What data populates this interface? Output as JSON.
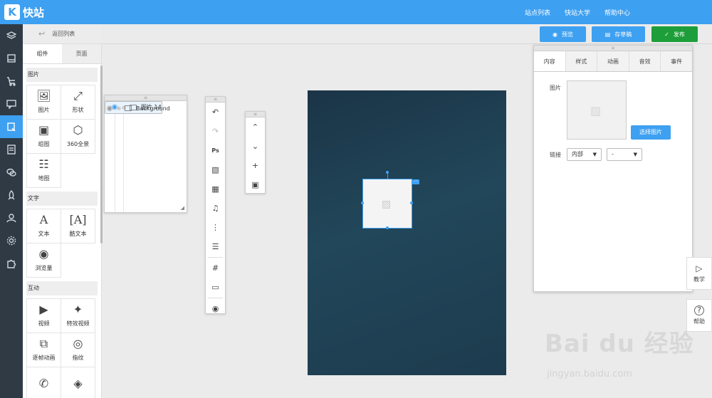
{
  "topbar": {
    "logo_mark": "K",
    "app_title": "快站",
    "nav": [
      "站点列表",
      "快站大学",
      "帮助中心"
    ]
  },
  "sidebar_icons": [
    "layers-icon",
    "page-icon",
    "cart-icon",
    "chat-icon",
    "edit-page-icon",
    "list-icon",
    "wechat-icon",
    "rocket-icon",
    "user-icon",
    "gear-icon",
    "puzzle-icon"
  ],
  "back": {
    "label": "返回列表"
  },
  "component_tabs": [
    "组件",
    "页面"
  ],
  "categories": {
    "image": {
      "title": "图片",
      "items": [
        "图片",
        "形状",
        "组图",
        "360全景",
        "地图"
      ]
    },
    "text": {
      "title": "文字",
      "items": [
        "文本",
        "酷文本",
        "浏览量"
      ]
    },
    "interact": {
      "title": "互动",
      "items": [
        "视频",
        "特效视频",
        "逐帧动画",
        "指纹"
      ]
    }
  },
  "toolbar": {
    "preview": "预览",
    "save": "存草稿",
    "publish": "发布"
  },
  "layers": [
    {
      "name": "图片 14",
      "selected": true
    },
    {
      "name": "Background",
      "selected": false
    }
  ],
  "props": {
    "tabs": [
      "内容",
      "样式",
      "动画",
      "音效",
      "事件"
    ],
    "image_label": "图片",
    "choose_button": "选择图片",
    "link_label": "链接",
    "link_type": "内部",
    "link_target": "-"
  },
  "side_buttons": {
    "tutorial": "教学",
    "help": "帮助"
  },
  "watermark": {
    "brand": "Bai du 经验",
    "url": "jingyan.baidu.com"
  },
  "colors": {
    "accent": "#3ea0f1",
    "publish": "#1d9e3a",
    "sidebar": "#2f3a45",
    "canvas": "#1f3d50"
  }
}
